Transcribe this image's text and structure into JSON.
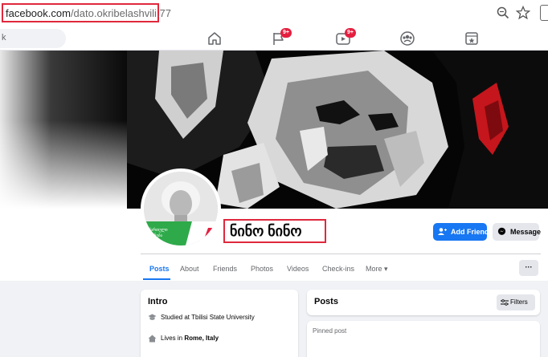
{
  "browser": {
    "url_host": "facebook.com",
    "url_path": "/dato.okribelashvili.77",
    "highlight_color": "#e0283c"
  },
  "fbnav": {
    "search_placeholder": "k",
    "friends_badge": "9+",
    "watch_badge": "9+"
  },
  "profile": {
    "name": "ნინო ნინო",
    "add_friend_label": "Add Friend",
    "message_label": "Message",
    "more_dots": "···"
  },
  "tabs": [
    {
      "label": "Posts"
    },
    {
      "label": "About"
    },
    {
      "label": "Friends"
    },
    {
      "label": "Photos"
    },
    {
      "label": "Videos"
    },
    {
      "label": "Check-ins"
    },
    {
      "label": "More ▾"
    }
  ],
  "intro": {
    "title": "Intro",
    "studied": "Studied at Tbilisi State University",
    "lives_prefix": "Lives in ",
    "lives_place": "Rome, Italy"
  },
  "posts": {
    "title": "Posts",
    "filters_label": "Filters",
    "pinned_label": "Pinned post"
  },
  "colors": {
    "fb_blue": "#1877f2",
    "badge_red": "#e41e3f"
  }
}
